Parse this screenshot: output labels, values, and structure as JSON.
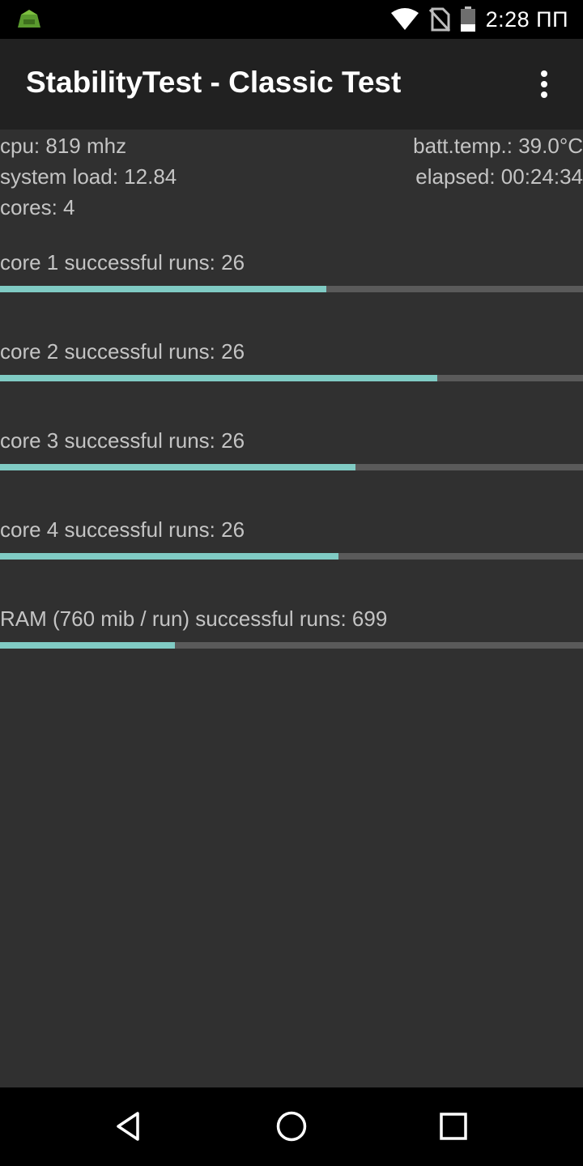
{
  "status_bar": {
    "time": "2:28 ПП",
    "icons": [
      "app-notification-icon",
      "wifi-icon",
      "no-sim-icon",
      "battery-icon"
    ]
  },
  "app_bar": {
    "title": "StabilityTest - Classic Test",
    "menu_icon": "more-vert-icon"
  },
  "info": {
    "cpu": "cpu: 819 mhz",
    "batt_temp": "batt.temp.: 39.0°C",
    "system_load": "system load: 12.84",
    "elapsed": "elapsed: 00:24:34",
    "cores": "cores: 4"
  },
  "tests": [
    {
      "label": "core 1 successful runs: 26",
      "progress": 0.56
    },
    {
      "label": "core 2 successful runs: 26",
      "progress": 0.75
    },
    {
      "label": "core 3 successful runs: 26",
      "progress": 0.61
    },
    {
      "label": "core 4 successful runs: 26",
      "progress": 0.58
    },
    {
      "label": "RAM (760 mib / run) successful runs: 699",
      "progress": 0.3
    }
  ],
  "colors": {
    "accent": "#80cbc4",
    "track": "#5a5a5a",
    "background": "#303030",
    "app_bar": "#212121",
    "text": "#c4c4c4"
  },
  "nav_bar": {
    "icons": [
      "back-icon",
      "home-icon",
      "recents-icon"
    ]
  }
}
